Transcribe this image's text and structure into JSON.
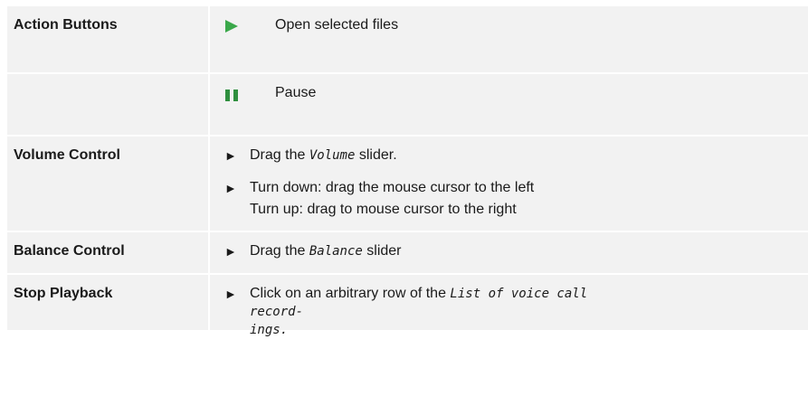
{
  "rows": [
    {
      "label": "Action Buttons",
      "icon": "play-icon",
      "icon_color": "#3aa84a",
      "text": "Open selected files"
    },
    {
      "label": "",
      "icon": "pause-icon",
      "icon_color": "#2f8f3f",
      "text": "Pause"
    },
    {
      "label": "Volume Control",
      "bullet1": {
        "pre": "Drag the ",
        "code": "Volume",
        "post": " slider."
      },
      "bullet2": {
        "line1": "Turn down: drag the mouse cursor to the left",
        "line2": "Turn up: drag to mouse cursor to the right"
      }
    },
    {
      "label": "Balance Control",
      "bullet": {
        "pre": "Drag the ",
        "code": "Balance",
        "post": " slider"
      }
    },
    {
      "label": "Stop Playback",
      "bullet": {
        "pre": "Click on an arbitrary row of the ",
        "code": "List of voice call record-",
        "code2": "ings."
      }
    }
  ],
  "bullet_glyph": "►"
}
